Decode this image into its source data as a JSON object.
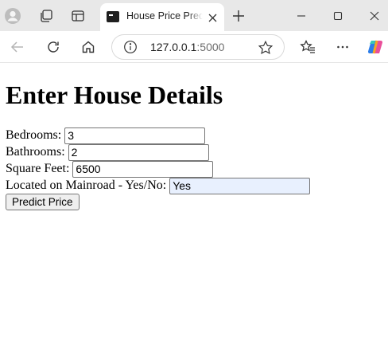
{
  "browser": {
    "tab_title": "House Price Prediction",
    "url_host": "127.0.0.1",
    "url_port": ":5000",
    "icons": {
      "profile": "profile-icon",
      "workspaces": "workspaces-icon",
      "tab_actions": "tab-actions-icon",
      "favicon": "terminal-favicon-icon",
      "close_tab": "close-icon",
      "new_tab": "plus-icon",
      "minimize": "minimize-icon",
      "maximize": "maximize-icon",
      "close_window": "close-icon",
      "back": "back-arrow-icon",
      "refresh": "refresh-icon",
      "home": "home-icon",
      "info": "info-icon",
      "favorite": "star-icon",
      "favorites": "favorites-icon",
      "more": "more-icon",
      "copilot": "copilot-icon"
    }
  },
  "page": {
    "heading": "Enter House Details",
    "fields": {
      "bedrooms": {
        "label": "Bedrooms:",
        "value": "3"
      },
      "bathrooms": {
        "label": "Bathrooms:",
        "value": "2"
      },
      "square_feet": {
        "label": "Square Feet:",
        "value": "6500"
      },
      "mainroad": {
        "label": "Located on Mainroad - Yes/No:",
        "value": "Yes"
      }
    },
    "submit_label": "Predict Price"
  },
  "colors": {
    "autofill_background": "#e8f0fe",
    "titlebar": "#e8e8e8"
  }
}
